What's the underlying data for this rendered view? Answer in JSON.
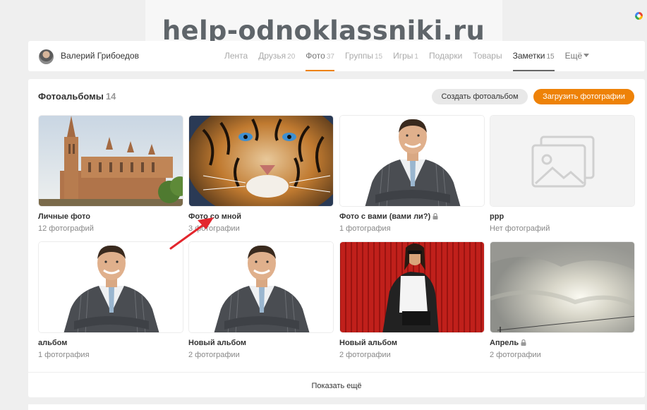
{
  "watermark": "help-odnoklassniki.ru",
  "user": {
    "name": "Валерий Грибоедов"
  },
  "nav": [
    {
      "label": "Лента",
      "count": "",
      "style": ""
    },
    {
      "label": "Друзья",
      "count": "20",
      "style": ""
    },
    {
      "label": "Фото",
      "count": "37",
      "style": "active"
    },
    {
      "label": "Группы",
      "count": "15",
      "style": ""
    },
    {
      "label": "Игры",
      "count": "1",
      "style": ""
    },
    {
      "label": "Подарки",
      "count": "",
      "style": ""
    },
    {
      "label": "Товары",
      "count": "",
      "style": ""
    },
    {
      "label": "Заметки",
      "count": "15",
      "style": "dark"
    },
    {
      "label": "Ещё",
      "count": "",
      "style": "more"
    }
  ],
  "albums_section": {
    "title": "Фотоальбомы",
    "count": "14",
    "create_label": "Создать фотоальбом",
    "upload_label": "Загрузить фотографии",
    "show_more": "Показать ещё"
  },
  "albums": [
    {
      "title": "Личные фото",
      "count": "12 фотографий",
      "thumb": "cathedral",
      "locked": false
    },
    {
      "title": "Фото со мной",
      "count": "3 фотографии",
      "thumb": "tiger",
      "locked": false
    },
    {
      "title": "Фото с вами (вами ли?)",
      "count": "1 фотография",
      "thumb": "man",
      "locked": true
    },
    {
      "title": "ррр",
      "count": "Нет фотографий",
      "thumb": "placeholder",
      "locked": false
    },
    {
      "title": "альбом",
      "count": "1 фотография",
      "thumb": "man",
      "locked": false
    },
    {
      "title": "Новый альбом",
      "count": "2 фотографии",
      "thumb": "man",
      "locked": false
    },
    {
      "title": "Новый альбом",
      "count": "2 фотографии",
      "thumb": "woman",
      "locked": false
    },
    {
      "title": "Апрель",
      "count": "2 фотографии",
      "thumb": "sky",
      "locked": true
    }
  ],
  "colors": {
    "accent": "#ee8208",
    "annotation": "#e3262d"
  }
}
